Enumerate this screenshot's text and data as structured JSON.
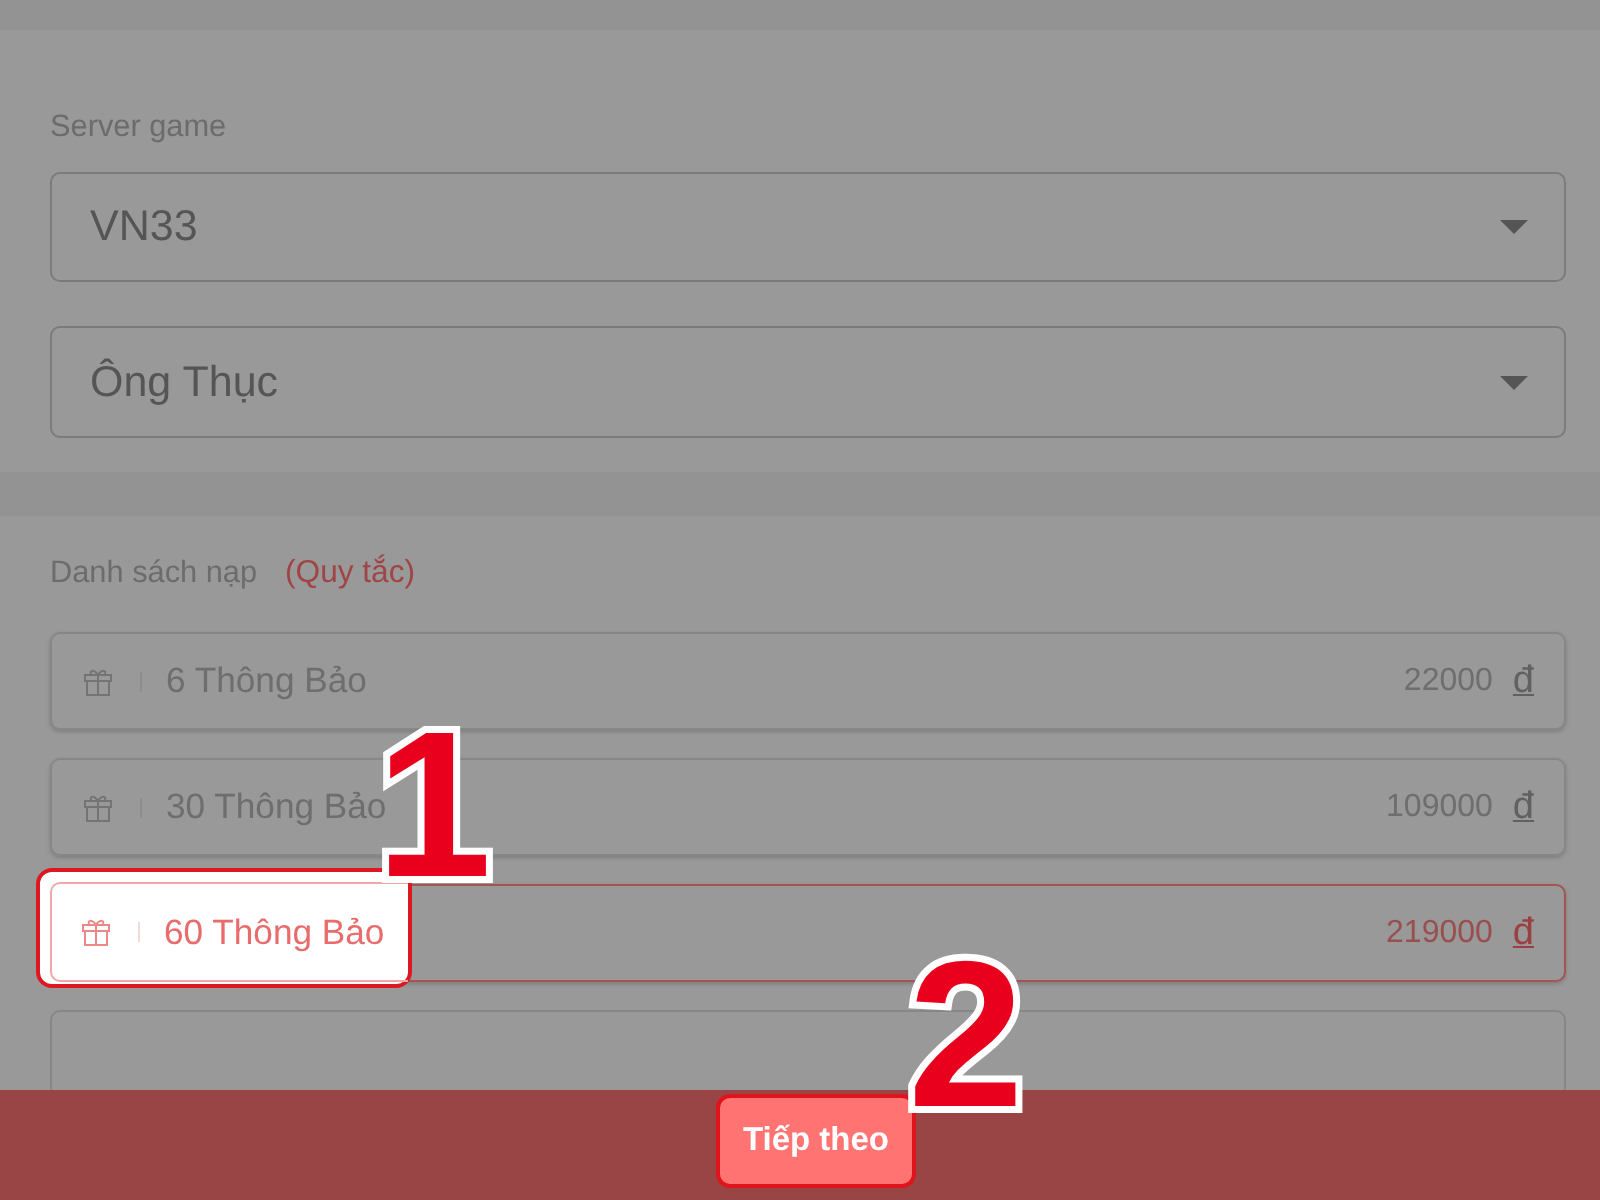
{
  "server_section": {
    "label": "Server game",
    "server_select": {
      "value": "VN33"
    },
    "character_select": {
      "value": "Ông Thục"
    }
  },
  "packages_section": {
    "label": "Danh sách nạp",
    "rules_link": "(Quy tắc)",
    "packages": [
      {
        "kind": "option",
        "name": "6 Thông Bảo",
        "price": "22000",
        "currency": "đ",
        "selected": false,
        "highlighted": false
      },
      {
        "kind": "option",
        "name": "30 Thông Bảo",
        "price": "109000",
        "currency": "đ",
        "selected": false,
        "highlighted": false
      },
      {
        "kind": "option",
        "name": "60 Thông Bảo",
        "price": "219000",
        "currency": "đ",
        "selected": true,
        "highlighted": true,
        "step": "1"
      },
      {
        "kind": "cut",
        "selected": false
      }
    ]
  },
  "footer": {
    "next_button": {
      "label": "Tiếp theo",
      "highlighted": true,
      "step": "2"
    }
  }
}
